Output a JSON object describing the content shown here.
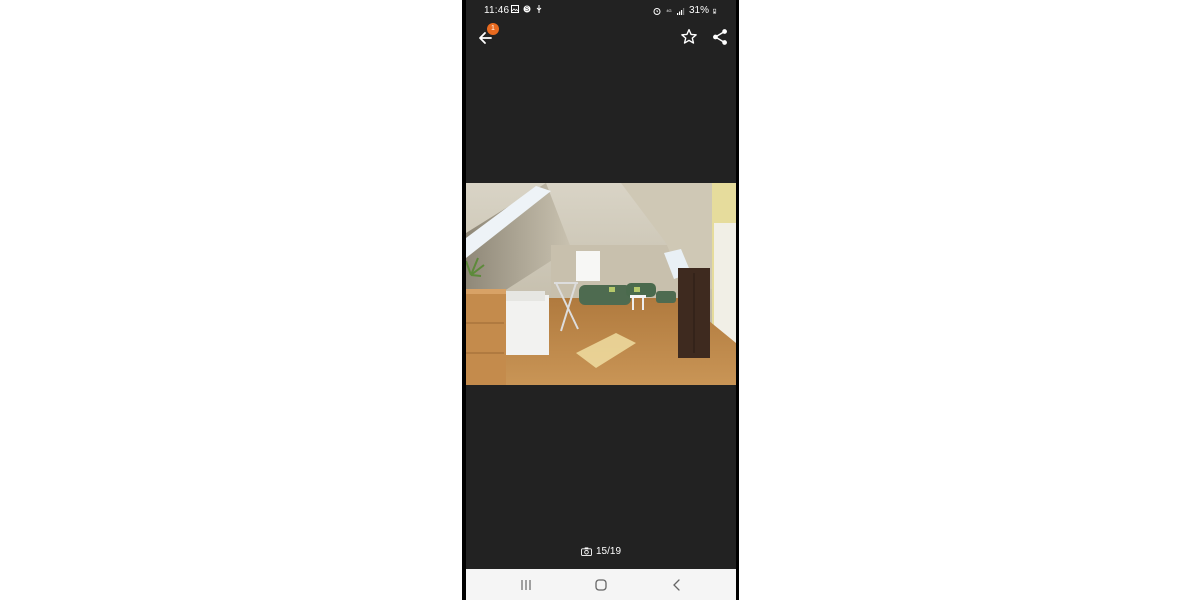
{
  "status": {
    "time": "11:46",
    "battery": "31%",
    "left_icons": [
      "gallery-icon",
      "sync-icon",
      "usb-icon"
    ],
    "right_icons": [
      "alarm-icon",
      "data-4g-icon",
      "signal-icon",
      "battery-icon"
    ]
  },
  "toolbar": {
    "back_icon": "arrow-left-icon",
    "notification_count": "1",
    "favorite_icon": "star-outline-icon",
    "share_icon": "share-icon"
  },
  "gallery": {
    "image_description_icon": "room-photo",
    "counter": "15/19",
    "counter_icon": "camera-icon"
  },
  "navigation": {
    "buttons": [
      "recent-apps-icon",
      "home-icon",
      "back-icon"
    ]
  },
  "colors": {
    "background": "#222222",
    "badge": "#e86a1f",
    "nav_bar": "#f5f5f5"
  }
}
